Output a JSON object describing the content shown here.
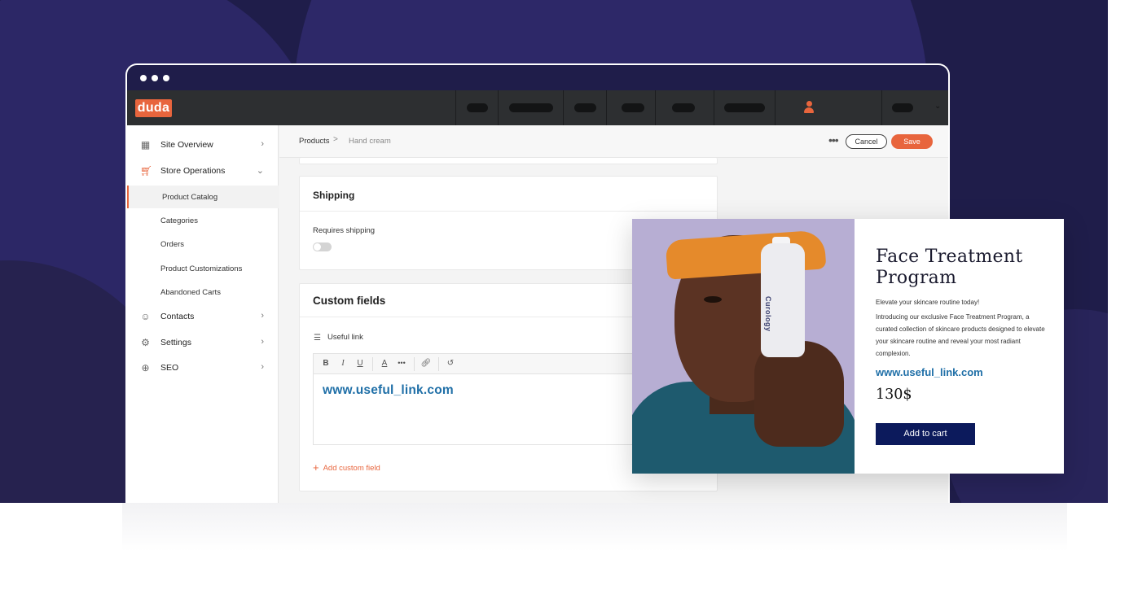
{
  "app": {
    "logo": "duda"
  },
  "sidebar": {
    "items": [
      {
        "label": "Site Overview",
        "icon": "grid-icon"
      },
      {
        "label": "Store Operations",
        "icon": "cart-icon"
      },
      {
        "label": "Contacts",
        "icon": "users-icon"
      },
      {
        "label": "Settings",
        "icon": "gear-icon"
      },
      {
        "label": "SEO",
        "icon": "seo-icon"
      }
    ],
    "subitems": [
      "Product Catalog",
      "Categories",
      "Orders",
      "Product Customizations",
      "Abandoned Carts"
    ],
    "active_subitem": "Product Catalog"
  },
  "breadcrumb": {
    "parent": "Products",
    "separator": ">",
    "current": "Hand cream"
  },
  "header": {
    "more": "•••",
    "cancel_label": "Cancel",
    "save_label": "Save"
  },
  "shipping": {
    "title": "Shipping",
    "requires_label": "Requires shipping",
    "requires_value": false
  },
  "custom_fields": {
    "title": "Custom fields",
    "field_label": "Useful link",
    "toolbar": [
      "B",
      "I",
      "U",
      "A",
      "•••",
      "link",
      "undo"
    ],
    "editor_value": "www.useful_link.com",
    "add_label": "Add custom field"
  },
  "product": {
    "title": "Face Treatment Program",
    "tagline": "Elevate your skincare routine today!",
    "description": "Introducing our exclusive Face Treatment Program, a curated collection of skincare products designed to elevate your skincare routine and reveal your most radiant complexion.",
    "link": "www.useful_link.com",
    "price": "130$",
    "cta": "Add to cart",
    "bottle_brand": "Curology"
  },
  "colors": {
    "accent": "#e8653d",
    "link": "#1f6fa7",
    "cta": "#0c1a5c",
    "backdrop": "#1f1d4a"
  }
}
